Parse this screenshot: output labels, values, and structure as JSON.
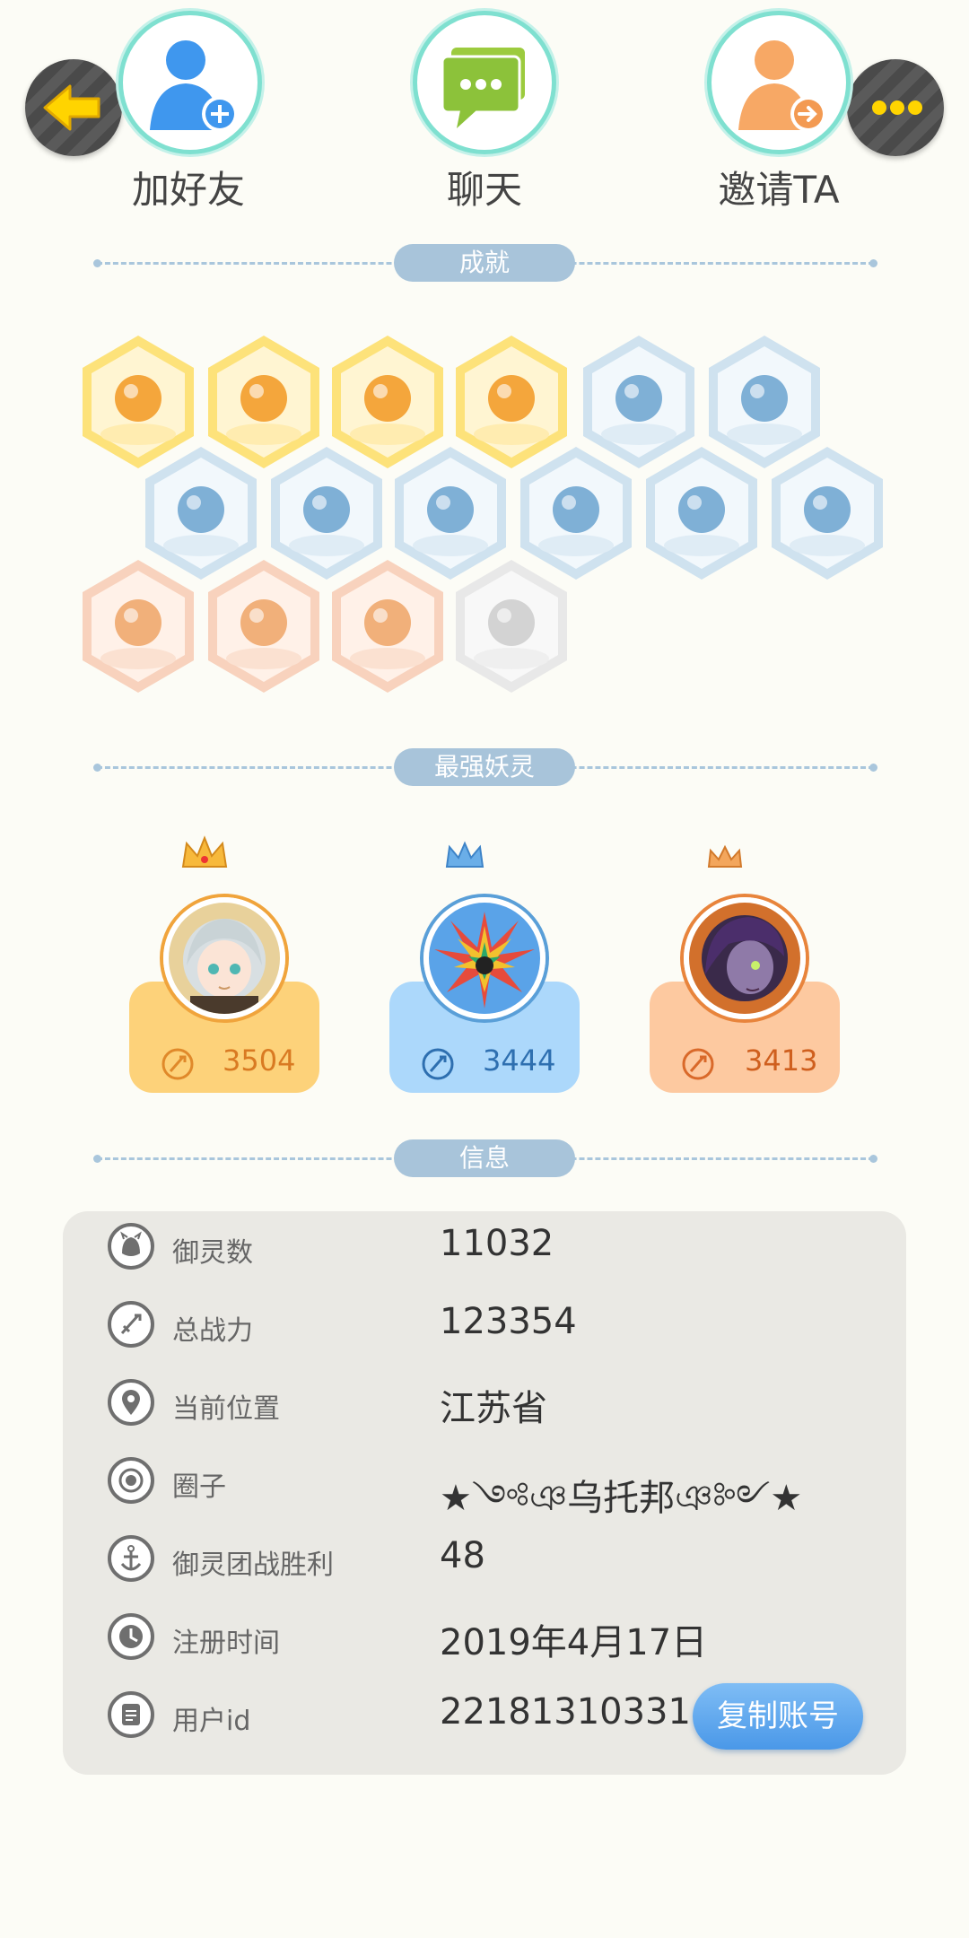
{
  "actions": {
    "add_friend": "加好友",
    "chat": "聊天",
    "invite": "邀请TA"
  },
  "sections": {
    "achievements": "成就",
    "top_spirits": "最强妖灵",
    "info": "信息"
  },
  "achievements": {
    "badges": [
      {
        "icon": "sun-emblem-icon",
        "tier": "gold"
      },
      {
        "icon": "cat-face-icon",
        "tier": "gold"
      },
      {
        "icon": "gold-orb-icon",
        "tier": "gold"
      },
      {
        "icon": "yin-yang-comet-icon",
        "tier": "gold"
      },
      {
        "icon": "sneaker-icon",
        "tier": "blue"
      },
      {
        "icon": "moon-orb-icon",
        "tier": "blue"
      },
      {
        "icon": "crystal-icon",
        "tier": "blue"
      },
      {
        "icon": "spirit-statue-icon",
        "tier": "blue"
      },
      {
        "icon": "cat-spirit-icon",
        "tier": "blue"
      },
      {
        "icon": "taiji-stone-icon",
        "tier": "blue"
      },
      {
        "icon": "scroll-emblem-icon",
        "tier": "blue"
      },
      {
        "icon": "fox-book-icon",
        "tier": "blue"
      },
      {
        "icon": "cat-cart-icon",
        "tier": "bronze"
      },
      {
        "icon": "ox-figure-icon",
        "tier": "bronze"
      },
      {
        "icon": "twin-figures-icon",
        "tier": "bronze"
      },
      {
        "icon": "dragon-statue-icon",
        "tier": "locked"
      }
    ]
  },
  "top_spirits": [
    {
      "rank": 1,
      "score": "3504",
      "color": "#fdd27a",
      "ring": "#f0a43c",
      "avatar_icon": "silver-hair-girl-avatar"
    },
    {
      "rank": 2,
      "score": "3444",
      "color": "#acd8fb",
      "ring": "#5a9fd8",
      "avatar_icon": "spiky-crystal-beast-avatar"
    },
    {
      "rank": 3,
      "score": "3413",
      "color": "#fdc9a0",
      "ring": "#e8843c",
      "avatar_icon": "purple-hair-girl-avatar"
    }
  ],
  "info": {
    "rows": [
      {
        "label": "御灵数",
        "value": "11032",
        "icon": "spirit-count-icon"
      },
      {
        "label": "总战力",
        "value": "123354",
        "icon": "sword-icon"
      },
      {
        "label": "当前位置",
        "value": "江苏省",
        "icon": "location-pin-icon"
      },
      {
        "label": "圈子",
        "value": "★༺ঞ乌托邦ঞ༻★",
        "icon": "circle-target-icon"
      },
      {
        "label": "御灵团战胜利",
        "value": "48",
        "icon": "anchor-icon"
      },
      {
        "label": "注册时间",
        "value": "2019年4月17日",
        "icon": "clock-icon"
      },
      {
        "label": "用户id",
        "value": "22181310331",
        "icon": "id-card-icon"
      }
    ],
    "copy_button": "复制账号"
  }
}
